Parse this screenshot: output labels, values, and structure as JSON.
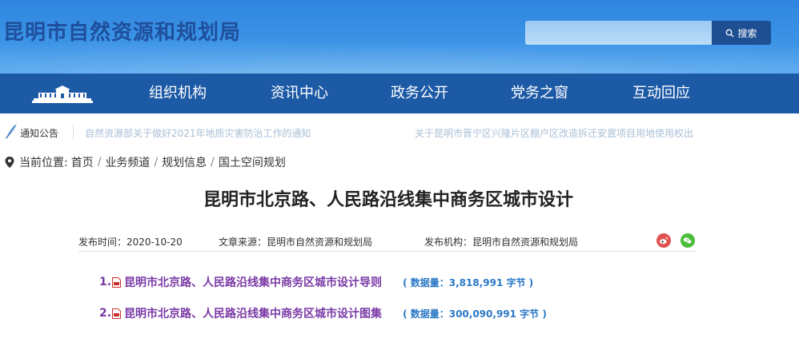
{
  "header": {
    "site_title": "昆明市自然资源和规划局",
    "search": {
      "placeholder": "",
      "button_label": "搜索"
    }
  },
  "nav": {
    "items": [
      {
        "label": "组织机构"
      },
      {
        "label": "资讯中心"
      },
      {
        "label": "政务公开"
      },
      {
        "label": "党务之窗"
      },
      {
        "label": "互动回应"
      }
    ]
  },
  "notice": {
    "label": "通知公告",
    "items": [
      "自然资源部关于做好2021年地质灾害防治工作的通知",
      "关于昆明市晋宁区兴隆片区棚户区改造拆迁安置项目用地使用权出"
    ]
  },
  "breadcrumb": {
    "prefix": "当前位置:",
    "items": [
      "首页",
      "业务频道",
      "规划信息",
      "国土空间规划"
    ],
    "separator": "/"
  },
  "article": {
    "title": "昆明市北京路、人民路沿线集中商务区城市设计",
    "meta": {
      "publish_time": "发布时间：2020-10-20",
      "source": "文章来源：昆明市自然资源和规划局",
      "agency": "发布机构：昆明市自然资源和规划局"
    },
    "files": [
      {
        "number": "1.",
        "name": "昆明市北京路、人民路沿线集中商务区城市设计导则",
        "size": "( 数据量：3,818,991 字节 )"
      },
      {
        "number": "2.",
        "name": "昆明市北京路、人民路沿线集中商务区城市设计图集",
        "size": "( 数据量：300,090,991 字节 )"
      }
    ]
  },
  "colors": {
    "header_blue": "#3b93e6",
    "nav_blue": "#1d5aa6",
    "title_blue": "#1f4f9c",
    "file_link_purple": "#7a3aa6",
    "size_blue": "#2a78c6",
    "weibo_red": "#e0524f",
    "wechat_green": "#4cbf3a"
  },
  "icons": [
    "search-icon",
    "building-logo-icon",
    "feather-quill-icon",
    "location-pin-icon",
    "weibo-icon",
    "wechat-icon",
    "pdf-file-icon"
  ]
}
